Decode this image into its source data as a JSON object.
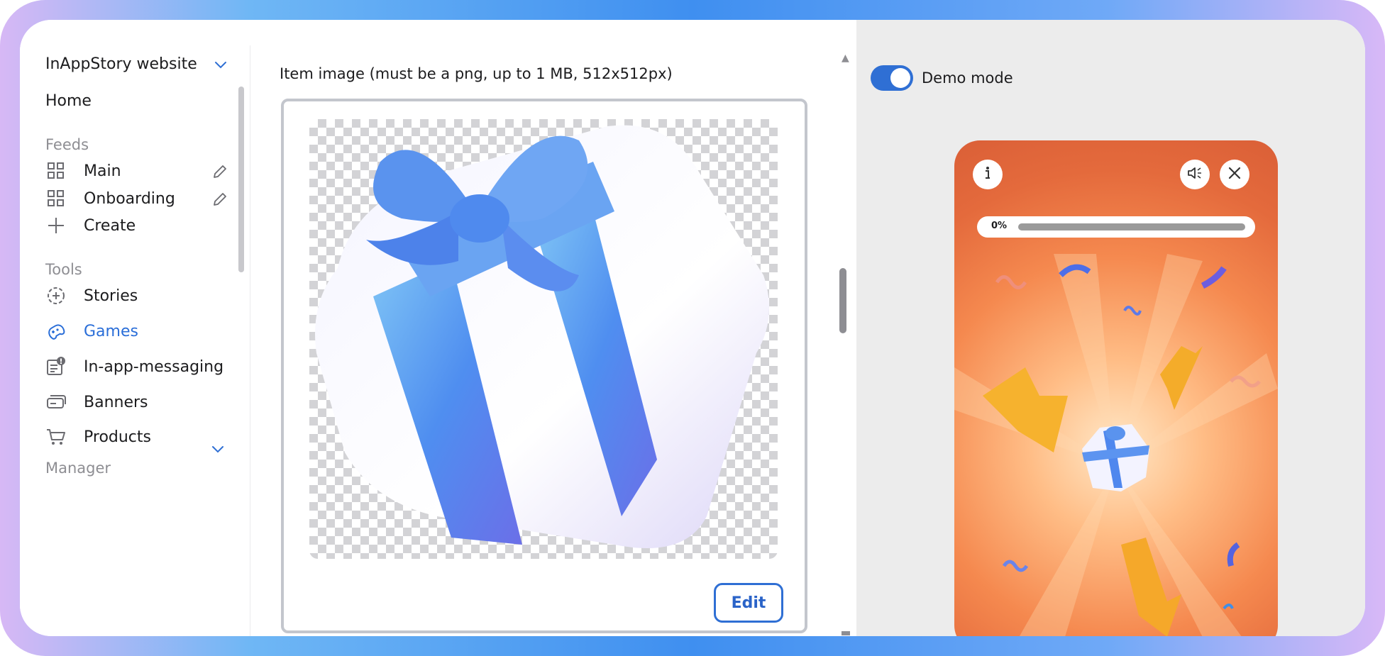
{
  "workspace": {
    "name": "InAppStory website"
  },
  "nav": {
    "home": "Home",
    "feeds_heading": "Feeds",
    "feeds": [
      {
        "label": "Main"
      },
      {
        "label": "Onboarding"
      }
    ],
    "create": "Create",
    "tools_heading": "Tools",
    "tools": [
      {
        "label": "Stories",
        "icon": "stories-icon"
      },
      {
        "label": "Games",
        "icon": "gamepad-icon",
        "active": true
      },
      {
        "label": "In-app-messaging",
        "icon": "message-icon"
      },
      {
        "label": "Banners",
        "icon": "banner-icon"
      },
      {
        "label": "Products",
        "icon": "cart-icon"
      }
    ],
    "manager_heading": "Manager"
  },
  "editor": {
    "image_label": "Item image (must be a png, up to 1 MB, 512x512px)",
    "edit_button": "Edit"
  },
  "preview": {
    "demo_mode_label": "Demo mode",
    "demo_mode_on": true,
    "progress_label": "0%",
    "progress_value": 0
  },
  "colors": {
    "accent": "#2f6fd4",
    "active_nav": "#2a6ed8",
    "preview_bg": "#e46a3c"
  }
}
